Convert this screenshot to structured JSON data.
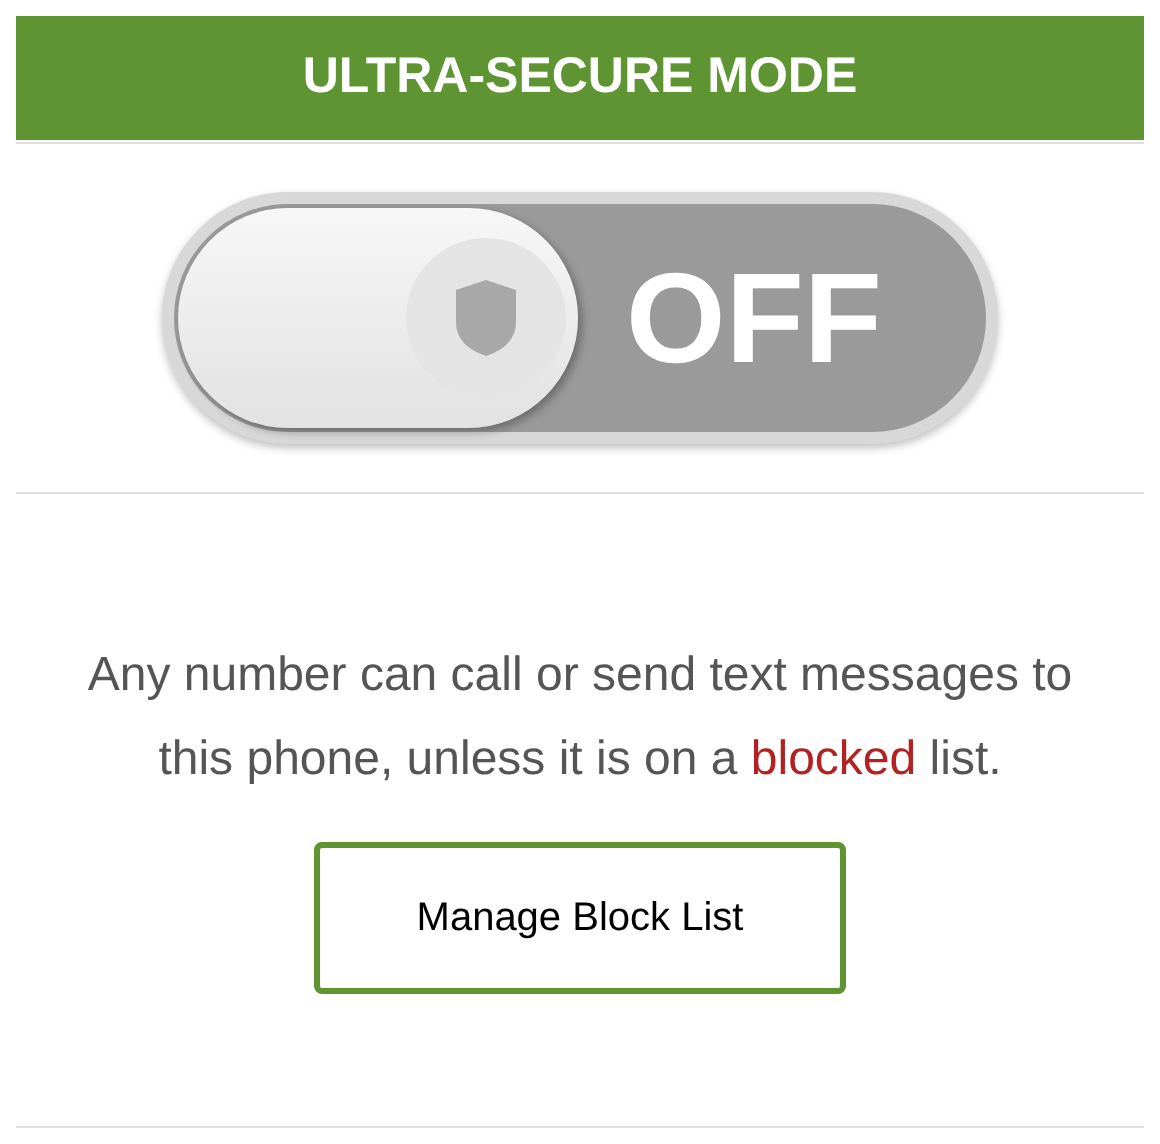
{
  "header": {
    "title": "ULTRA-SECURE MODE"
  },
  "toggle": {
    "on": false,
    "label": "OFF"
  },
  "message": {
    "before": "Any number can call or send text messages to this phone, unless it is on a ",
    "link": "blocked",
    "after": " list."
  },
  "button": {
    "label": "Manage Block List"
  }
}
